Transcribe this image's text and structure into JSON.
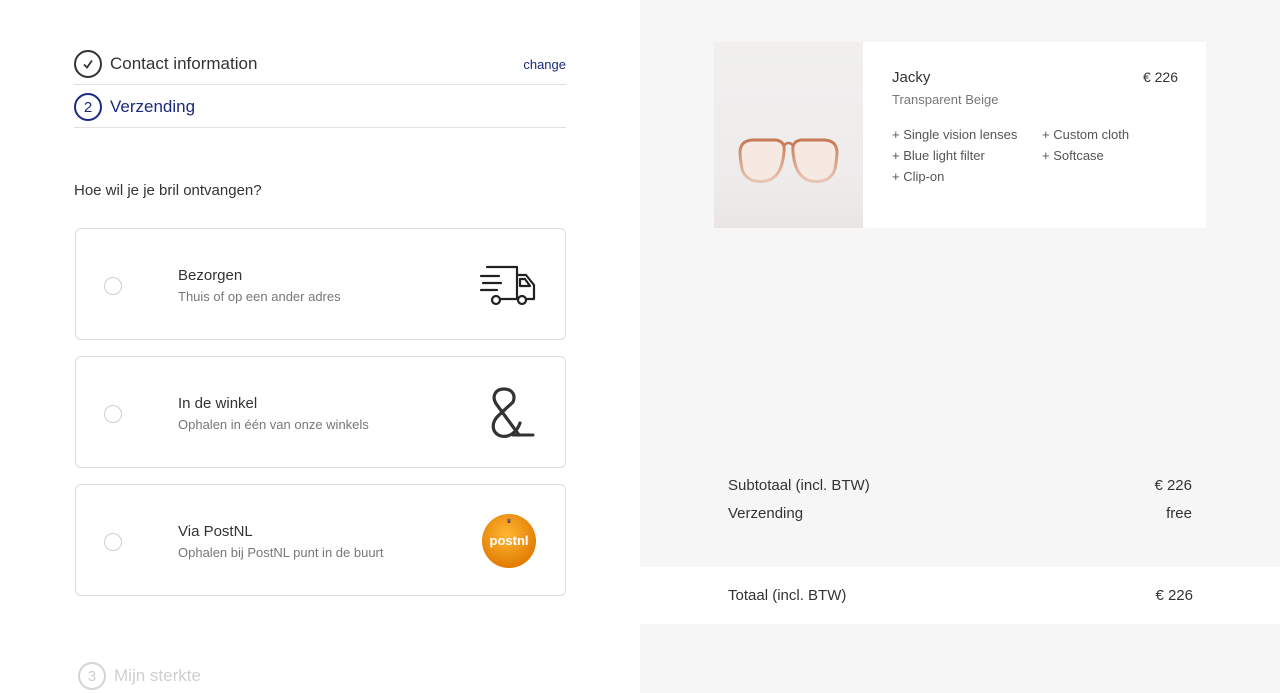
{
  "steps": {
    "contact": {
      "title": "Contact information",
      "change_label": "change"
    },
    "shipping": {
      "number": "2",
      "title": "Verzending"
    },
    "strength": {
      "number": "3",
      "title": "Mijn sterkte"
    }
  },
  "question": "Hoe wil je je bril ontvangen?",
  "options": [
    {
      "title": "Bezorgen",
      "subtitle": "Thuis of op een ander adres",
      "icon": "delivery-truck-icon"
    },
    {
      "title": "In de winkel",
      "subtitle": "Ophalen in één van onze winkels",
      "icon": "ampersand-logo-icon"
    },
    {
      "title": "Via PostNL",
      "subtitle": "Ophalen bij PostNL punt in de buurt",
      "icon": "postnl-logo",
      "logo_text": "postnl"
    }
  ],
  "product": {
    "name": "Jacky",
    "price": "€ 226",
    "variant": "Transparent Beige",
    "extras": [
      "+ Single vision lenses",
      "+ Custom cloth",
      "+ Blue light filter",
      "+ Softcase",
      "+ Clip-on"
    ]
  },
  "summary": {
    "subtotal_label": "Subtotaal (incl. BTW)",
    "subtotal_value": "€ 226",
    "shipping_label": "Verzending",
    "shipping_value": "free",
    "total_label": "Totaal (incl. BTW)",
    "total_value": "€ 226"
  },
  "colors": {
    "accent": "#1a2a7c",
    "postnl_orange": "#f39200",
    "right_bg": "#f6f6f6"
  }
}
